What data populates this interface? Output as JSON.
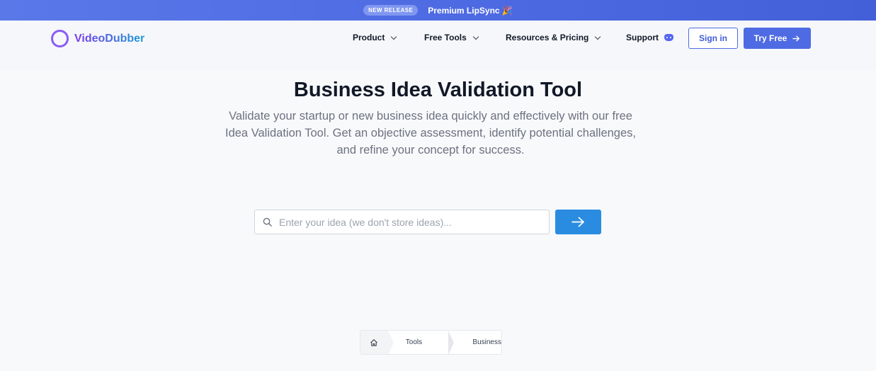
{
  "announcement": {
    "badge": "NEW RELEASE",
    "text": "Premium LipSync 🎉"
  },
  "nav": {
    "logo": "VideoDubber",
    "items": [
      {
        "label": "Product"
      },
      {
        "label": "Free Tools"
      },
      {
        "label": "Resources & Pricing"
      },
      {
        "label": "Support"
      }
    ],
    "signin": "Sign in",
    "try_free": "Try Free"
  },
  "hero": {
    "title": "Business Idea Validation Tool",
    "description": "Validate your startup or new business idea quickly and effectively with our free Idea Validation Tool. Get an objective assessment, identify potential challenges, and refine your concept for success."
  },
  "search": {
    "placeholder": "Enter your idea (we don't store ideas)...",
    "value": ""
  },
  "breadcrumb": {
    "items": [
      "Tools",
      "Business"
    ]
  },
  "colors": {
    "brand": "#4f6be3",
    "action": "#2a8ce0",
    "logo_ring": "#8b5cf6"
  },
  "icons": {
    "search": "search-icon",
    "submit": "arrow-right-icon",
    "home": "home-icon",
    "support": "discord-icon"
  }
}
